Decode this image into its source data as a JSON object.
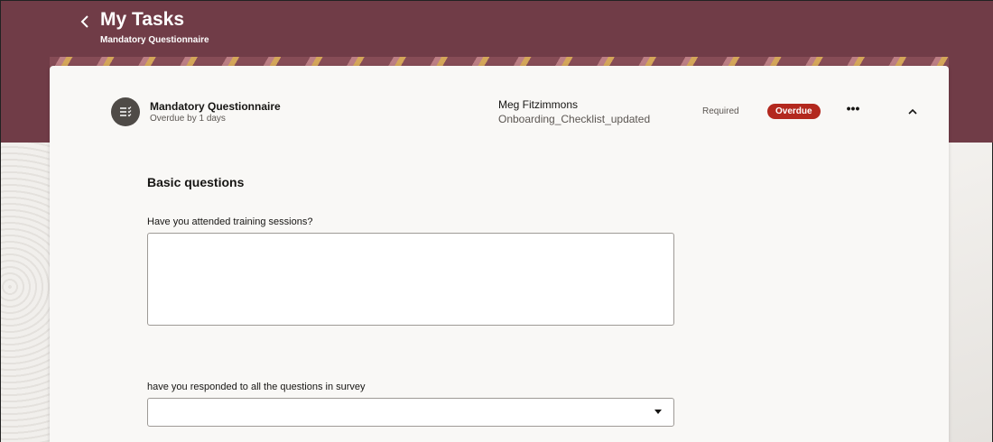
{
  "header": {
    "title": "My Tasks",
    "subtitle": "Mandatory Questionnaire",
    "back_icon": "chevron-left-icon",
    "brand_color": "#703c47"
  },
  "task": {
    "name": "Mandatory Questionnaire",
    "overdue_text": "Overdue by 1 days",
    "icon": "checklist-icon",
    "assignee": "Meg Fitzimmons",
    "checklist": "Onboarding_Checklist_updated",
    "requirement": "Required",
    "status": "Overdue",
    "status_color": "#b3281e",
    "more_label": "•••",
    "collapse_icon": "chevron-up-icon"
  },
  "form": {
    "section_title": "Basic questions",
    "questions": [
      {
        "label": "Have you attended training sessions?",
        "type": "textarea",
        "value": ""
      },
      {
        "label": "have you responded to all the questions in survey",
        "type": "select",
        "value": ""
      }
    ]
  }
}
